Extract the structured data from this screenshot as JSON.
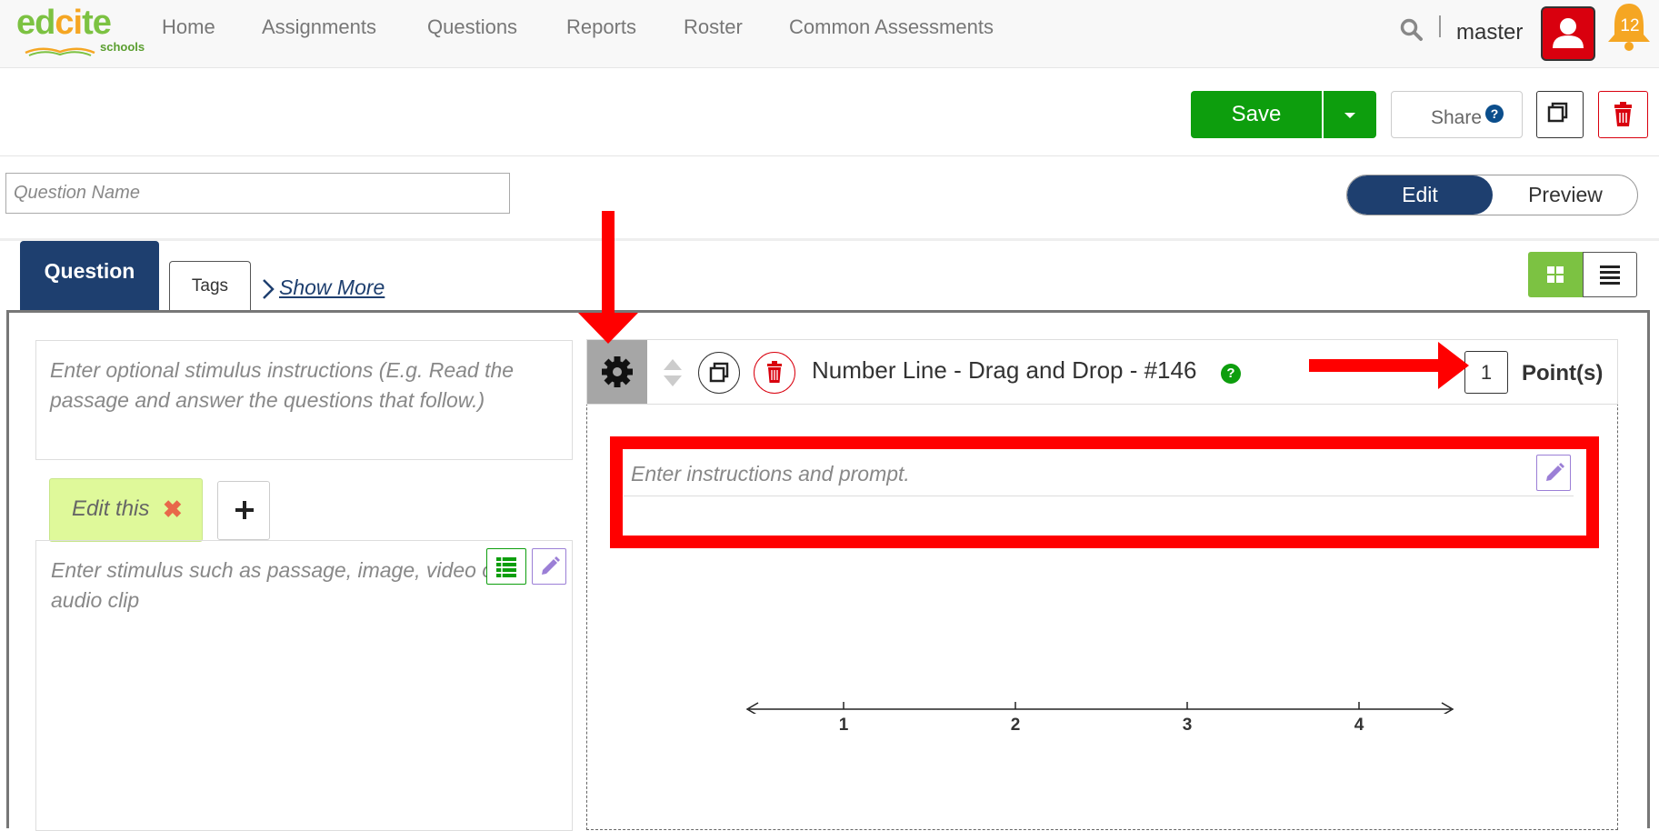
{
  "brand": {
    "logo_text_main": "edcite",
    "logo_text_sub": "schools"
  },
  "nav": {
    "items": [
      {
        "label": "Home"
      },
      {
        "label": "Assignments"
      },
      {
        "label": "Questions"
      },
      {
        "label": "Reports"
      },
      {
        "label": "Roster"
      },
      {
        "label": "Common Assessments"
      }
    ],
    "username": "master",
    "notification_count": "12"
  },
  "toolbar": {
    "save_label": "Save",
    "share_label": "Share",
    "share_help": "?"
  },
  "question_name": {
    "placeholder": "Question Name",
    "value": ""
  },
  "mode_toggle": {
    "edit_label": "Edit",
    "preview_label": "Preview",
    "active": "Edit"
  },
  "tabs": {
    "question_label": "Question",
    "tags_label": "Tags",
    "show_more_label": "Show More"
  },
  "stimulus": {
    "instructions_placeholder": "Enter optional stimulus instructions (E.g. Read the passage and answer the questions that follow.)",
    "tab_label": "Edit this",
    "body_placeholder": "Enter stimulus such as passage, image, video or audio clip"
  },
  "question": {
    "title": "Number Line - Drag and Drop - #146",
    "help": "?",
    "points_value": "1",
    "points_label": "Point(s)",
    "prompt_placeholder": "Enter instructions and prompt."
  },
  "number_line": {
    "ticks": [
      "1",
      "2",
      "3",
      "4"
    ],
    "left_cap": "<",
    "right_cap": ">"
  },
  "colors": {
    "brand_green": "#7cc242",
    "save_green": "#0d9e0d",
    "navy": "#1e3f6f",
    "danger_red": "#d9000e",
    "annotation_red": "#ff0000",
    "bell_orange": "#f5a623"
  },
  "icons": {
    "search": "search-icon",
    "user": "user-icon",
    "bell": "bell-icon",
    "copy": "copy-icon",
    "trash": "trash-icon",
    "gear": "gear-icon",
    "grid": "grid-icon",
    "list": "list-icon",
    "pencil": "pencil-icon",
    "table": "table-icon",
    "plus": "plus-icon",
    "chevron": "chevron-right-icon",
    "move": "move-handle-icon"
  }
}
